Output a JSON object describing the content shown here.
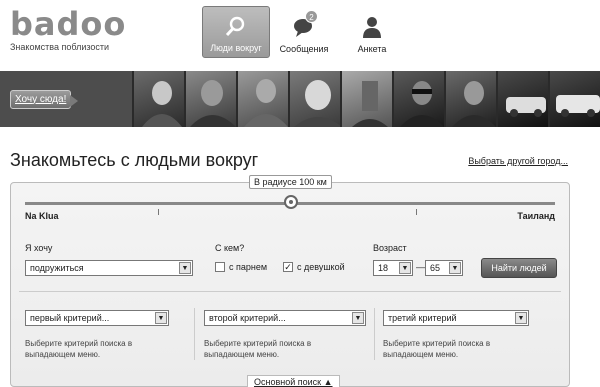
{
  "header": {
    "logo_text": "badoo",
    "tagline": "Знакомства поблизости",
    "nav": [
      {
        "label": "Люди вокруг",
        "icon": "search-icon",
        "active": true
      },
      {
        "label": "Сообщения",
        "icon": "chat-bubble-icon",
        "badge": "2"
      },
      {
        "label": "Анкета",
        "icon": "person-icon"
      }
    ]
  },
  "strip": {
    "cta_label": "Хочу сюда!"
  },
  "page": {
    "title": "Знакомьтесь с людьми вокруг",
    "other_city_link": "Выбрать другой город..."
  },
  "search": {
    "radius_label": "В радиусе 100 км",
    "place_left": "Na Klua",
    "place_right": "Таиланд",
    "want_label": "Я хочу",
    "want_value": "подружиться",
    "with_label": "С кем?",
    "with_man": "с парнем",
    "with_woman": "с девушкой",
    "with_woman_checked": true,
    "age_label": "Возраст",
    "age_from": "18",
    "age_dash": "—",
    "age_to": "65",
    "find_button": "Найти людей",
    "criteria": [
      {
        "value": "первый критерий...",
        "hint": "Выберите критерий поиска в выпадающем меню."
      },
      {
        "value": "второй критерий...",
        "hint": "Выберите критерий поиска в выпадающем меню."
      },
      {
        "value": "третий критерий",
        "hint": "Выберите критерий поиска в выпадающем меню."
      }
    ],
    "basic_search_link": "Основной поиск ▲"
  }
}
